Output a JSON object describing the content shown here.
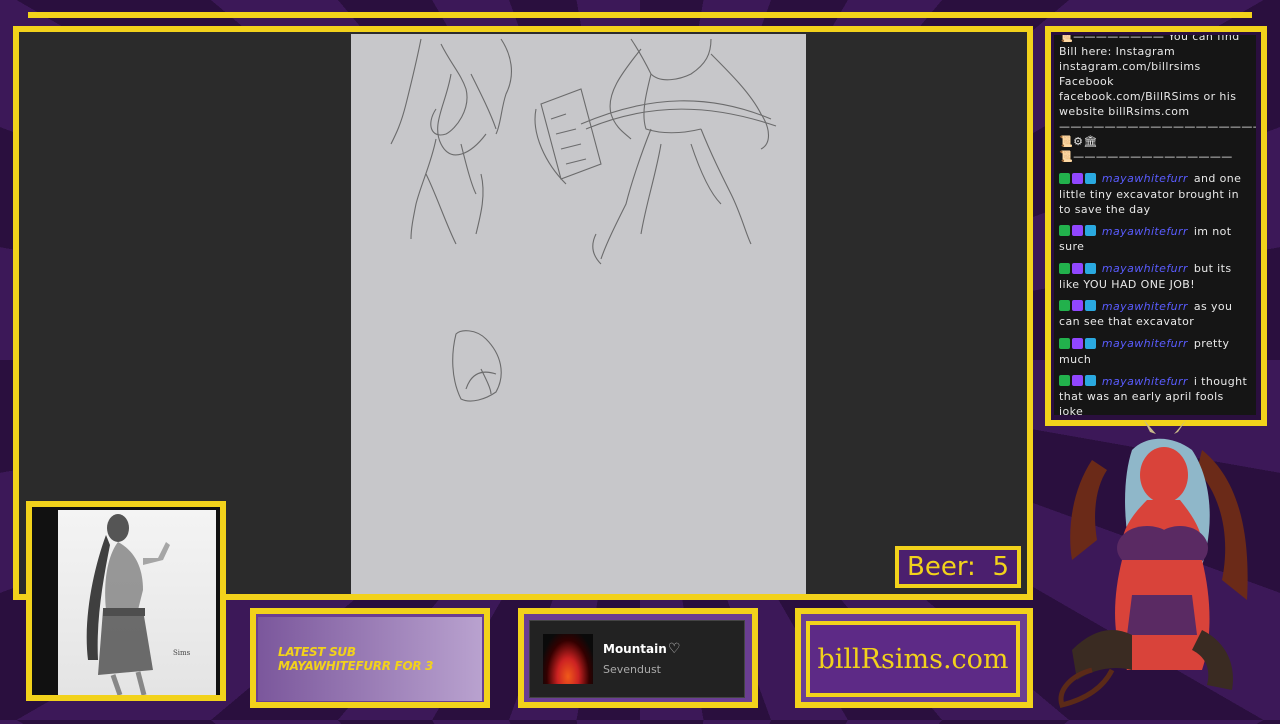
{
  "chat": {
    "header_lines": [
      "📜———————— You can find Bill here: Instagram instagram.com/billrsims Facebook facebook.com/BillRSims or his website billRsims.com",
      "———————————————————📜⚙🏛",
      "📜——————————————"
    ],
    "messages": [
      {
        "user": "mayawhitefurr",
        "text": "and one little tiny excavator brought in to save the day"
      },
      {
        "user": "mayawhitefurr",
        "text": "im not sure"
      },
      {
        "user": "mayawhitefurr",
        "text": "but its like YOU HAD ONE JOB!"
      },
      {
        "user": "mayawhitefurr",
        "text": "as you can see that excavator"
      },
      {
        "user": "mayawhitefurr",
        "text": "pretty much"
      },
      {
        "user": "mayawhitefurr",
        "text": "i thought that was an early april fools joke"
      }
    ]
  },
  "beer": {
    "label": "Beer:",
    "count": "5"
  },
  "latest_sub": {
    "title": "LATEST SUB",
    "value": "MAYAWHITEFURR FOR 3"
  },
  "now_playing": {
    "title": "Mountain",
    "artist": "Sevendust"
  },
  "website": {
    "label": "billRsims.com"
  },
  "colors": {
    "accent": "#f2d21b",
    "purple": "#5d2a86",
    "canvas": "#c7c7ca"
  },
  "icons": [
    "heart-icon",
    "edit-badge-icon",
    "subscriber-badge-icon",
    "crown-badge-icon"
  ]
}
